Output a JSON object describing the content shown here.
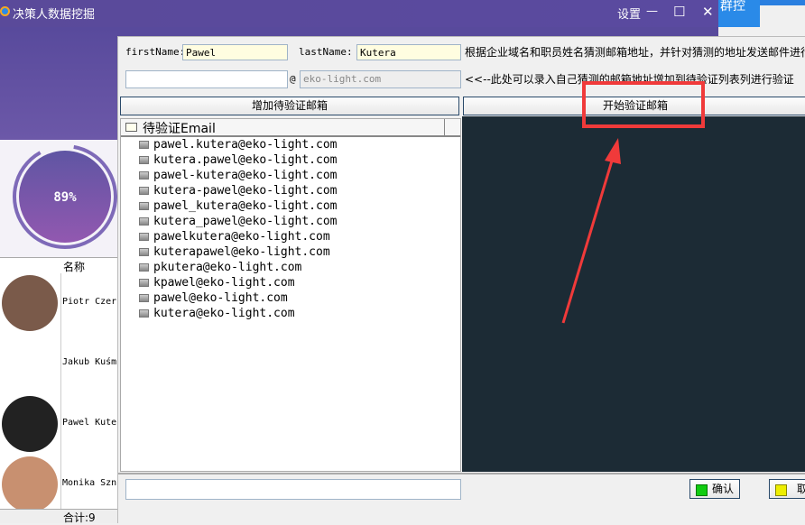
{
  "window": {
    "title": "决策人数据挖掘",
    "settings": "设置",
    "minimize": "—",
    "maximize": "☐",
    "close": "✕",
    "qunkong": "群控"
  },
  "gauge": {
    "value": 89,
    "label": "89%"
  },
  "table": {
    "header": "名称",
    "rows": [
      {
        "name": "Piotr Czer"
      },
      {
        "name": "Jakub Kuśm"
      },
      {
        "name": "Pawel Kute"
      },
      {
        "name": "Monika Szn"
      }
    ],
    "footer": "合计:9"
  },
  "form": {
    "first_label": "firstName:",
    "first_value": "Pawel",
    "last_label": "lastName:",
    "last_value": "Kutera",
    "hint1": "根据企业域名和职员姓名猜测邮箱地址，并针对猜测的地址发送邮件进行",
    "custom_value": "",
    "at": "@",
    "domain_placeholder": "eko-light.com",
    "hint2": "<<--此处可以录入自己猜测的邮箱地址增加到待验证列表列进行验证"
  },
  "buttons": {
    "add": "增加待验证邮箱",
    "start": "开始验证邮箱",
    "confirm": "确认",
    "cancel": "取消"
  },
  "list": {
    "header": "待验证Email",
    "items": [
      "pawel.kutera@eko-light.com",
      "kutera.pawel@eko-light.com",
      "pawel-kutera@eko-light.com",
      "kutera-pawel@eko-light.com",
      "pawel_kutera@eko-light.com",
      "kutera_pawel@eko-light.com",
      "pawelkutera@eko-light.com",
      "kuterapawel@eko-light.com",
      "pkutera@eko-light.com",
      "kpawel@eko-light.com",
      "pawel@eko-light.com",
      "kutera@eko-light.com"
    ]
  },
  "bottom": {
    "input_value": ""
  },
  "colors": {
    "annotation": "#f03a3a",
    "panel": "#1c2b35"
  }
}
